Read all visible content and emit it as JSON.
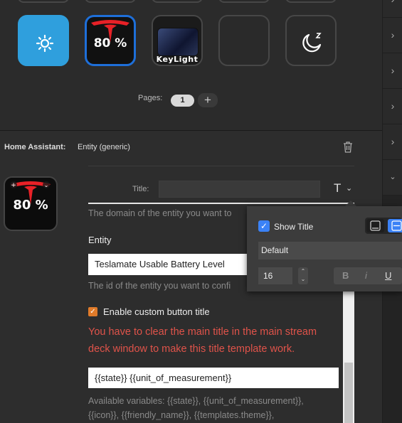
{
  "pages": {
    "label": "Pages:",
    "current": "1",
    "add": "+"
  },
  "keys": {
    "tesla_text": "80 %",
    "keylight_text": "KeyLight"
  },
  "inspector": {
    "plugin_label": "Home Assistant:",
    "action_value": "Entity (generic)",
    "preview_text": "80 %",
    "title_label": "Title:",
    "title_value": "",
    "domain_help": "The domain of the entity you want to",
    "entity_heading": "Entity",
    "entity_value": "Teslamate Usable Battery Level",
    "entity_help": "The id of the entity you want to confi",
    "custom_title_label": "Enable custom button title",
    "warning_line1": "You have to clear the main title in the main stream",
    "warning_line2": "deck window to make this title template work.",
    "template_value": "{{state}} {{unit_of_measurement}}",
    "vars_line1": "Available variables: {{state}}, {{unit_of_measurement}},",
    "vars_line2": "{{icon}}, {{friendly_name}}, {{templates.theme}},"
  },
  "title_popover": {
    "show_title_label": "Show Title",
    "font_value": "Default",
    "size_value": "16",
    "bold": "B",
    "italic": "i",
    "underline": "U"
  },
  "icons": [
    "brightness-icon",
    "tesla-logo-icon",
    "sleep-icon",
    "trash-icon",
    "title-format-icon",
    "chevron-right-icon",
    "chevron-down-icon",
    "checkmark-icon"
  ],
  "colors": {
    "accent_blue": "#3b82f6",
    "brightness_key": "#2f9fdd",
    "warning_red": "#e0534a",
    "checkbox_orange": "#e07b2a",
    "tesla_red": "#e82127"
  }
}
